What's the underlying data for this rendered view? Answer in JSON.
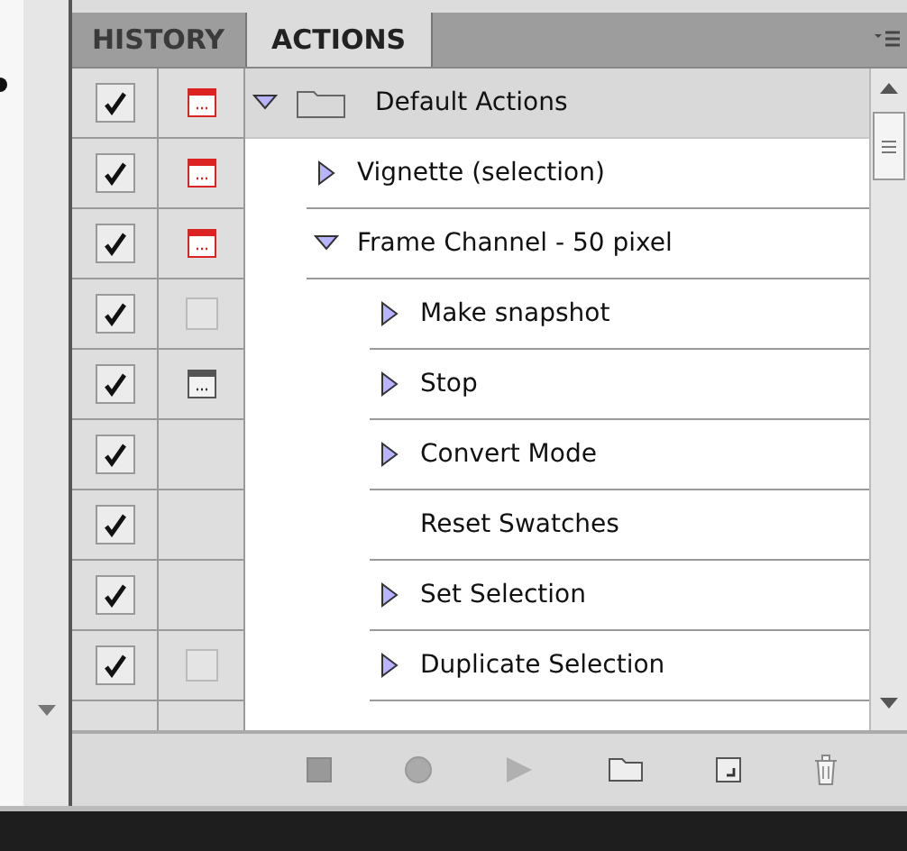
{
  "tabs": [
    {
      "label": "HISTORY",
      "selected": false
    },
    {
      "label": "ACTIONS",
      "selected": true
    }
  ],
  "actions": [
    {
      "kind": "set",
      "name": "Default Actions",
      "checked": true,
      "has_dialog": true,
      "dialog_on": true,
      "expanded": true,
      "children": [
        {
          "kind": "action",
          "name": "Vignette (selection)",
          "checked": true,
          "has_dialog": true,
          "dialog_on": true,
          "expanded": false
        },
        {
          "kind": "action",
          "name": "Frame Channel - 50 pixel",
          "checked": true,
          "has_dialog": true,
          "dialog_on": true,
          "expanded": true,
          "children": [
            {
              "kind": "command",
              "name": "Make snapshot",
              "checked": true,
              "has_dialog": false,
              "expanded": false
            },
            {
              "kind": "command",
              "name": "Stop",
              "checked": true,
              "has_dialog": true,
              "dialog_on": false,
              "expanded": false
            },
            {
              "kind": "command",
              "name": "Convert Mode",
              "checked": true,
              "expanded": false
            },
            {
              "kind": "command",
              "name": "Reset Swatches",
              "checked": true
            },
            {
              "kind": "command",
              "name": "Set Selection",
              "checked": true,
              "expanded": false
            },
            {
              "kind": "command",
              "name": "Duplicate Selection",
              "checked": true,
              "has_dialog": false,
              "expanded": false
            }
          ]
        }
      ]
    }
  ]
}
